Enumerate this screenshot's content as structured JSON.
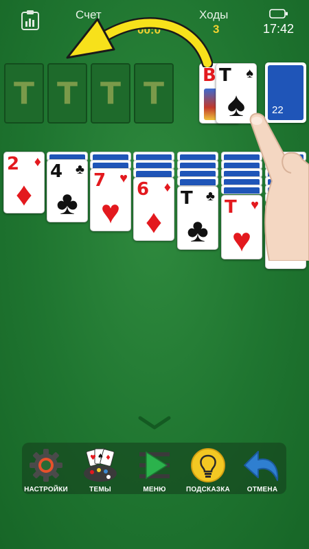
{
  "status_bar": {
    "score_label": "Счет",
    "score_value": "00:0",
    "moves_label": "Ходы",
    "moves_value": "3",
    "clock": "17:42"
  },
  "foundations": [
    "T",
    "T",
    "T",
    "T"
  ],
  "waste": [
    {
      "rank": "В",
      "suit": "♥",
      "color": "red"
    },
    {
      "rank": "T",
      "suit": "♠",
      "color": "black"
    }
  ],
  "stock": {
    "count": "22"
  },
  "tableau": [
    {
      "rank": "2",
      "suit": "♦",
      "color": "red"
    },
    {
      "rank": "4",
      "suit": "♣",
      "color": "black"
    },
    {
      "rank": "7",
      "suit": "♥",
      "color": "red"
    },
    {
      "rank": "6",
      "suit": "♦",
      "color": "red"
    },
    {
      "rank": "T",
      "suit": "♣",
      "color": "black"
    },
    {
      "rank": "T",
      "suit": "♥",
      "color": "red"
    },
    {
      "rank": "",
      "suit": "♠",
      "color": "black"
    }
  ],
  "toolbar": {
    "settings_label": "НАСТРОЙКИ",
    "themes_label": "ТЕМЫ",
    "menu_label": "МЕНЮ",
    "hint_label": "ПОДСКАЗКА",
    "undo_label": "ОТМЕНА"
  },
  "icons": {
    "settings": "gear-icon",
    "themes": "palette-cards-icon",
    "menu": "play-menu-icon",
    "hint": "lightbulb-icon",
    "undo": "undo-arrow-icon",
    "battery": "battery-icon",
    "stats": "clipboard-chart-icon",
    "collapse": "chevron-down-icon",
    "hint_arrow": "curved-arrow-icon",
    "hand": "pointing-hand-icon"
  },
  "colors": {
    "felt": "#1f7530",
    "card_back": "#1f55b8",
    "accent_yellow": "#f3d230",
    "suit_red": "#e3191e"
  }
}
